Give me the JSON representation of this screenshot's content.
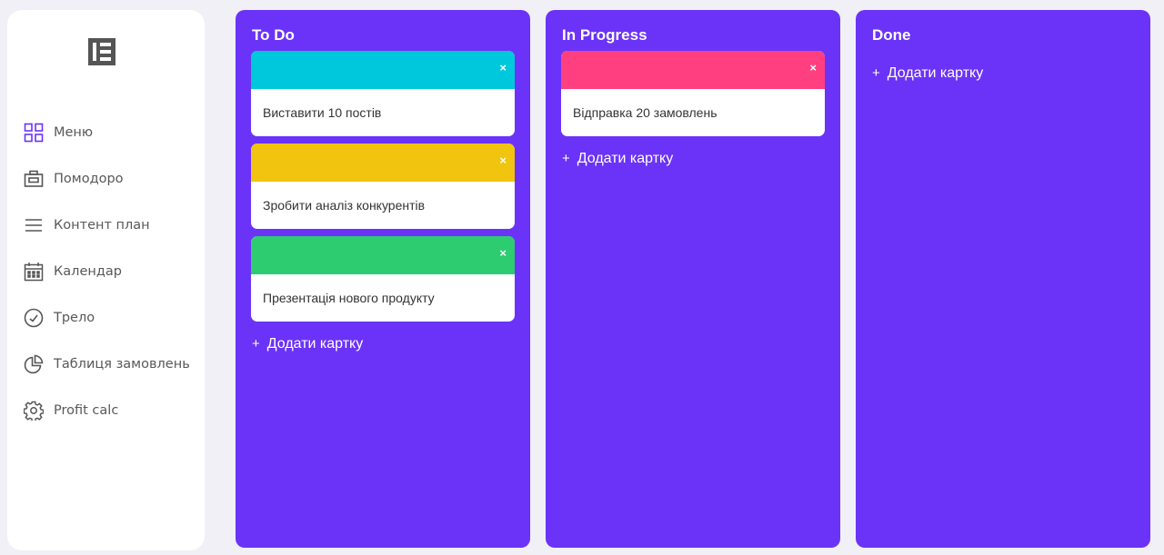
{
  "sidebar": {
    "logo_icon": "brand-logo",
    "items": [
      {
        "label": "Меню",
        "icon": "grid-icon"
      },
      {
        "label": "Помодоро",
        "icon": "timer-box-icon"
      },
      {
        "label": "Контент план",
        "icon": "list-icon"
      },
      {
        "label": "Календар",
        "icon": "calendar-icon"
      },
      {
        "label": "Трело",
        "icon": "check-circle-icon"
      },
      {
        "label": "Таблиця замовлень",
        "icon": "pie-chart-icon"
      },
      {
        "label": "Profit calc",
        "icon": "gear-icon"
      }
    ],
    "active_color": "#6b33f7"
  },
  "board": {
    "columns": [
      {
        "title": "To Do",
        "cards": [
          {
            "text": "Виставити 10 постів",
            "color": "#00c8dc",
            "close": "×"
          },
          {
            "text": "Зробити аналіз конкурентів",
            "color": "#f1c40f",
            "close": "×"
          },
          {
            "text": "Презентація нового продукту",
            "color": "#2ecc71",
            "close": "×"
          }
        ],
        "add_label": "Додати картку"
      },
      {
        "title": "In Progress",
        "cards": [
          {
            "text": "Відправка 20 замовлень",
            "color": "#ff3f7f",
            "close": "×"
          }
        ],
        "add_label": "Додати картку"
      },
      {
        "title": "Done",
        "cards": [],
        "add_label": "Додати картку"
      }
    ],
    "column_color": "#6b33f7",
    "add_plus": "+"
  }
}
